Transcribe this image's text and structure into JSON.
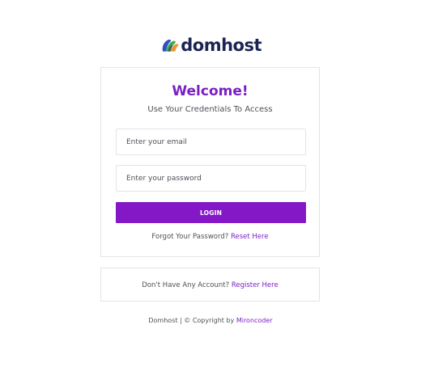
{
  "brand": {
    "name": "domhost",
    "logo_icon": "layered-waves-logo-icon",
    "colors": {
      "text": "#1d2451",
      "blue": "#2f4fc3",
      "green": "#3fae4d",
      "orange": "#f0913a"
    }
  },
  "login": {
    "title": "Welcome!",
    "subtitle": "Use Your Credentials To Access",
    "email_placeholder": "Enter your email",
    "password_placeholder": "Enter your password",
    "login_label": "LOGIN",
    "forgot_text": "Forgot Your Password?",
    "reset_link": "Reset Here"
  },
  "signup": {
    "text": "Don't Have Any Account?",
    "register_link": "Register Here"
  },
  "footer": {
    "text": "Domhost | © Copyright by",
    "author": "Mironcoder"
  },
  "colors": {
    "accent": "#7b1fc4",
    "button": "#8418c7",
    "border": "#e4e4ea",
    "body_text": "#4e5158"
  }
}
